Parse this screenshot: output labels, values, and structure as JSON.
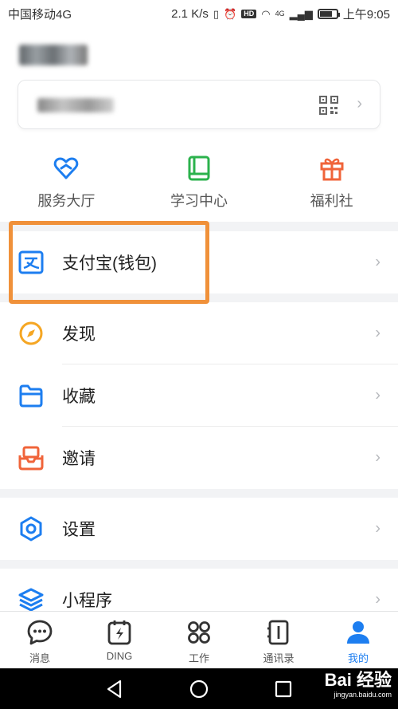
{
  "status_bar": {
    "carrier": "中国移动4G",
    "speed": "2.1 K/s",
    "hd_badge": "HD",
    "net_badge": "4G",
    "time": "上午9:05"
  },
  "quick_actions": [
    {
      "label": "服务大厅",
      "icon": "heart-service-icon",
      "color": "#1d7ef0"
    },
    {
      "label": "学习中心",
      "icon": "book-icon",
      "color": "#2bb24c"
    },
    {
      "label": "福利社",
      "icon": "gift-icon",
      "color": "#f0643a"
    }
  ],
  "menu": {
    "alipay": "支付宝(钱包)",
    "discover": "发现",
    "favorites": "收藏",
    "invite": "邀请",
    "settings": "设置",
    "mini_programs": "小程序"
  },
  "tabs": [
    {
      "label": "消息",
      "icon": "chat-icon",
      "active": false
    },
    {
      "label": "DING",
      "icon": "ding-icon",
      "active": false
    },
    {
      "label": "工作",
      "icon": "work-grid-icon",
      "active": false
    },
    {
      "label": "通讯录",
      "icon": "contacts-icon",
      "active": false
    },
    {
      "label": "我的",
      "icon": "profile-icon",
      "active": true
    }
  ],
  "watermark": {
    "brand": "Bai 经验",
    "domain": "jingyan.baidu.com"
  },
  "colors": {
    "accent_blue": "#1d7ef0",
    "green": "#2bb24c",
    "orange": "#f0643a",
    "yellow": "#f5a623",
    "highlight": "#f0913a"
  }
}
